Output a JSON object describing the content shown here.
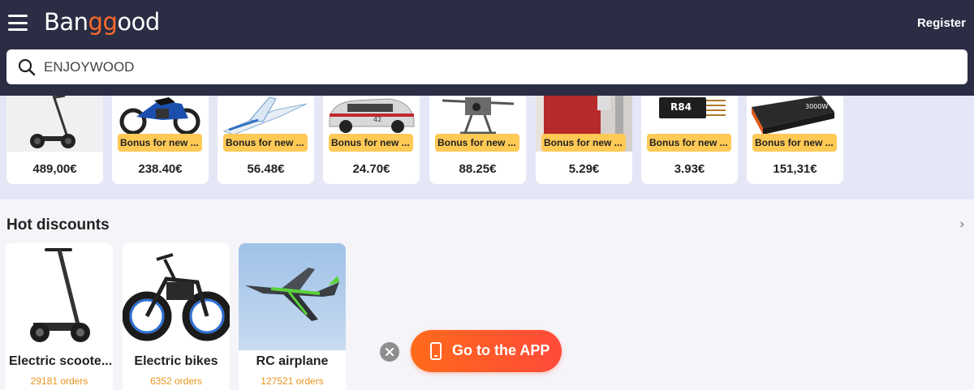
{
  "header": {
    "logo_part1": "Ban",
    "logo_part2": "gg",
    "logo_part3": "ood",
    "register_label": "Register",
    "menu_icon": "hamburger-menu-icon"
  },
  "search": {
    "value": "ENJOYWOOD",
    "icon": "search-icon"
  },
  "top_products": [
    {
      "price": "489,00€",
      "bonus": "",
      "icon": "electric-scooter"
    },
    {
      "price": "238.40€",
      "bonus": "Bonus for new ...",
      "icon": "kids-dirt-bike"
    },
    {
      "price": "56.48€",
      "bonus": "Bonus for new ...",
      "icon": "rc-glider"
    },
    {
      "price": "24.70€",
      "bonus": "Bonus for new ...",
      "icon": "rc-car"
    },
    {
      "price": "88.25€",
      "bonus": "Bonus for new ...",
      "icon": "drone"
    },
    {
      "price": "5.29€",
      "bonus": "Bonus for new ...",
      "icon": "clamp-tool"
    },
    {
      "price": "3.93€",
      "bonus": "Bonus for new ...",
      "icon": "rc-receiver"
    },
    {
      "price": "151,31€",
      "bonus": "Bonus for new ...",
      "icon": "power-inverter"
    }
  ],
  "hot_discounts": {
    "title": "Hot discounts",
    "more_icon": "chevron-right-icon",
    "items": [
      {
        "name": "Electric scoote...",
        "orders": "29181 orders",
        "icon": "electric-scooter"
      },
      {
        "name": "Electric bikes",
        "orders": "6352 orders",
        "icon": "electric-bike"
      },
      {
        "name": "RC airplane",
        "orders": "127521 orders",
        "icon": "rc-airplane"
      }
    ]
  },
  "app_promo": {
    "label": "Go to the APP",
    "close_icon": "close-icon",
    "phone_icon": "phone-icon"
  },
  "colors": {
    "header_bg": "#2a2d43",
    "accent": "#ff6a2a",
    "bonus_bg": "#ffc955",
    "orders_text": "#e8941e",
    "strip_bg": "#e5e7f6"
  }
}
